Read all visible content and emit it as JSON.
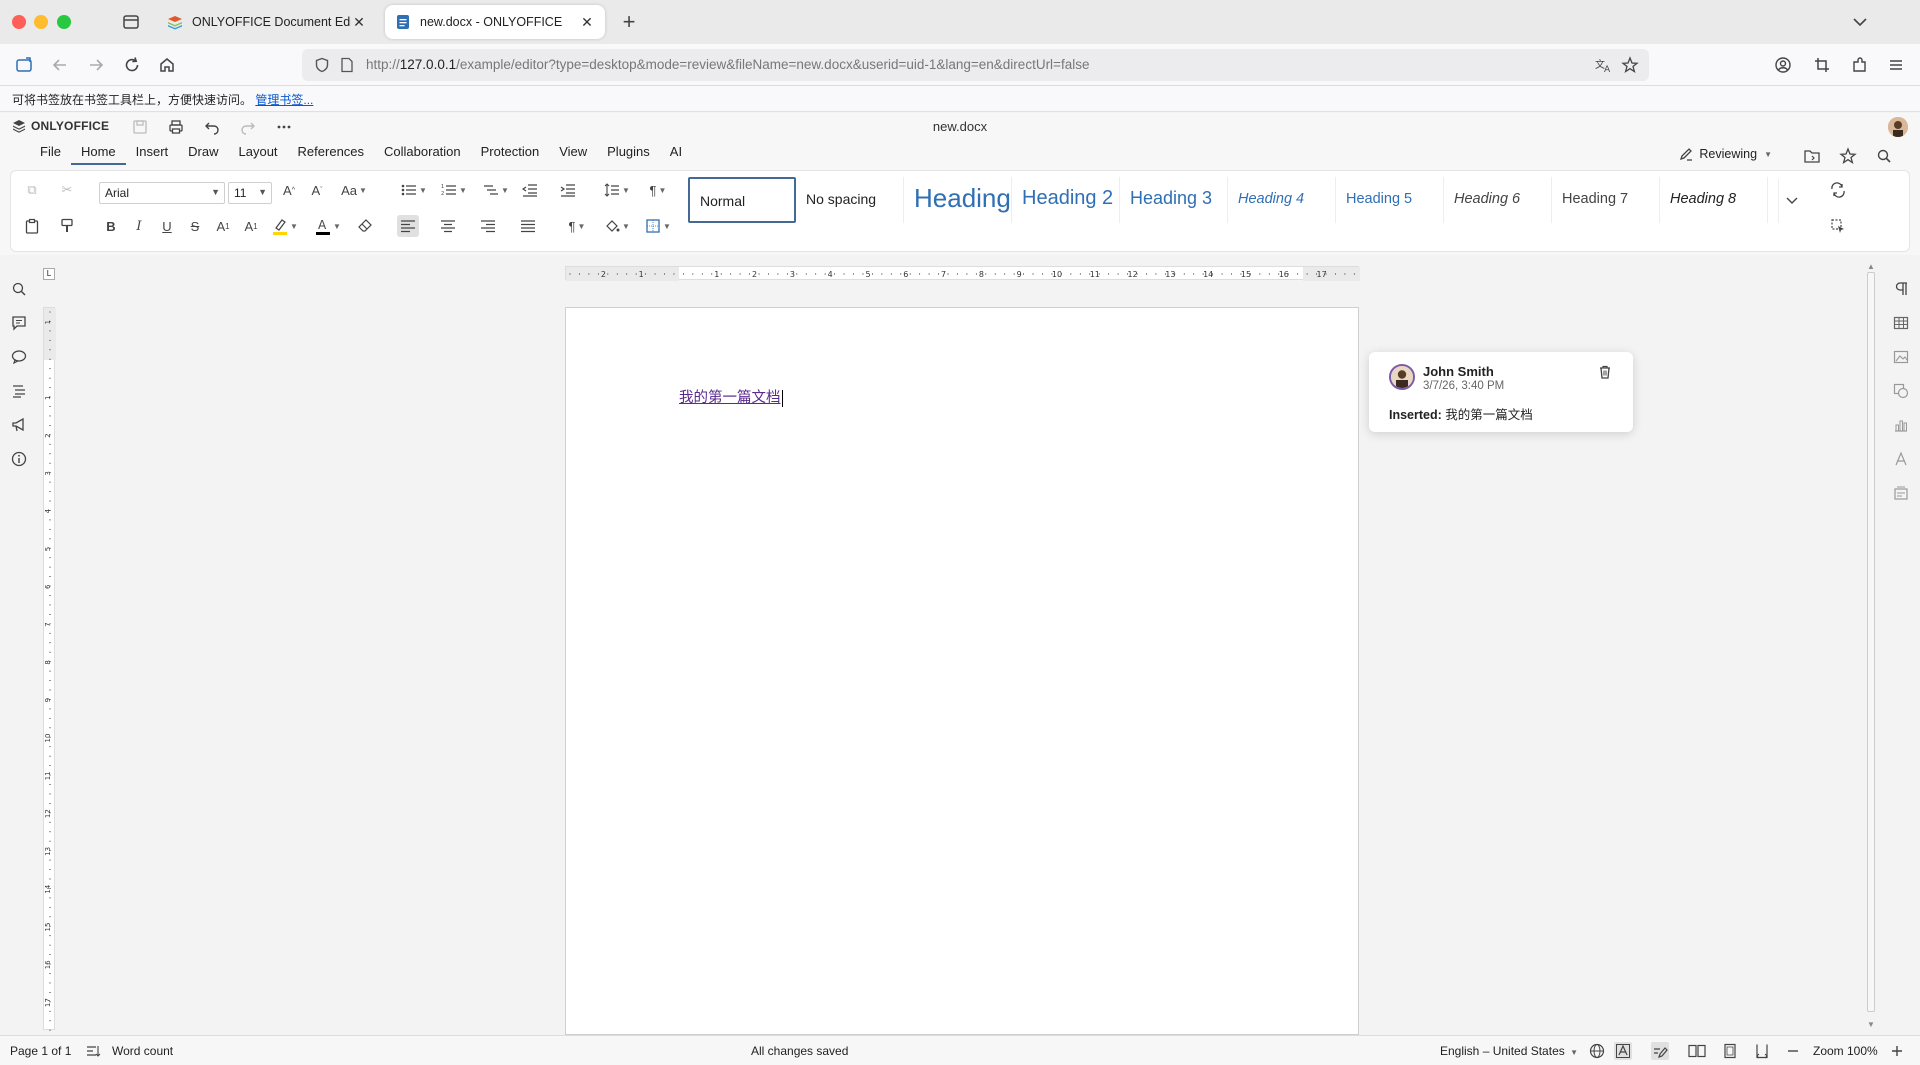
{
  "browser": {
    "tabs": [
      {
        "title": "ONLYOFFICE Document Editors",
        "active": false
      },
      {
        "title": "new.docx - ONLYOFFICE",
        "active": true
      }
    ],
    "url_prefix": "http://",
    "url_host": "127.0.0.1",
    "url_rest": "/example/editor?type=desktop&mode=review&fileName=new.docx&userid=uid-1&lang=en&directUrl=false",
    "bookmark_hint": "可将书签放在书签工具栏上，方便快速访问。",
    "bookmark_link": "管理书签..."
  },
  "editor": {
    "logo": "ONLYOFFICE",
    "doc_title": "new.docx",
    "menu": [
      "File",
      "Home",
      "Insert",
      "Draw",
      "Layout",
      "References",
      "Collaboration",
      "Protection",
      "View",
      "Plugins",
      "AI"
    ],
    "active_menu": "Home",
    "mode_label": "Reviewing",
    "font_name": "Arial",
    "font_size": "11",
    "styles": [
      "Normal",
      "No spacing",
      "Heading 1",
      "Heading 2",
      "Heading 3",
      "Heading 4",
      "Heading 5",
      "Heading 6",
      "Heading 7",
      "Heading 8"
    ],
    "selected_style": "Normal",
    "accent": "#446995",
    "highlight_color": "#ffd600",
    "font_color": "#000000"
  },
  "document": {
    "text": "我的第一篇文档"
  },
  "comment": {
    "author": "John Smith",
    "date": "3/7/26, 3:40 PM",
    "action": "Inserted:",
    "content": "我的第一篇文档"
  },
  "ruler": {
    "h_labels": [
      "2",
      "1",
      "1",
      "2",
      "3",
      "4",
      "5",
      "6",
      "7",
      "8",
      "9",
      "10",
      "11",
      "12",
      "13",
      "14",
      "15",
      "16",
      "17"
    ],
    "v_labels": [
      "1",
      "1",
      "2",
      "3",
      "4",
      "5",
      "6",
      "7",
      "8",
      "9",
      "10",
      "11",
      "12",
      "13",
      "14",
      "15",
      "16",
      "17"
    ]
  },
  "status": {
    "page": "Page 1 of 1",
    "word_count": "Word count",
    "save_state": "All changes saved",
    "language": "English – United States",
    "zoom": "Zoom 100%"
  }
}
